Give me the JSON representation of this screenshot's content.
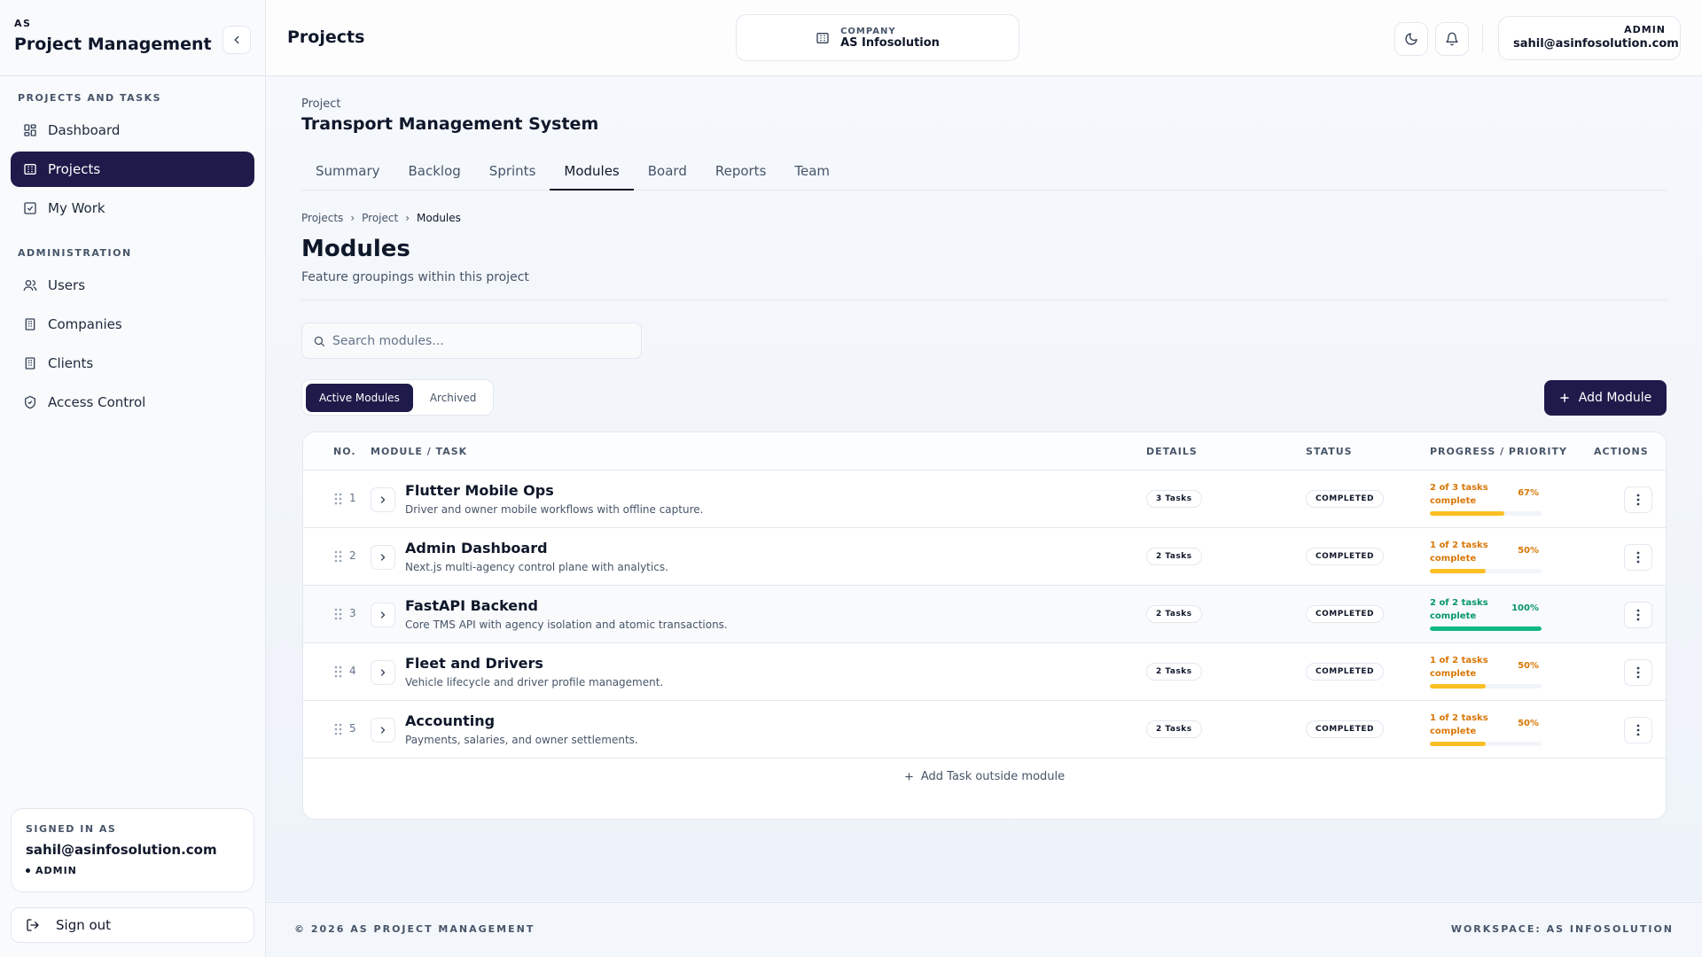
{
  "sidebar": {
    "brand_small": "AS",
    "brand_title": "Project Management",
    "sections": [
      {
        "label": "PROJECTS AND TASKS",
        "items": [
          {
            "label": "Dashboard",
            "icon": "dashboard-icon"
          },
          {
            "label": "Projects",
            "icon": "building-icon",
            "active": true
          },
          {
            "label": "My Work",
            "icon": "checkbox-icon"
          }
        ]
      },
      {
        "label": "ADMINISTRATION",
        "items": [
          {
            "label": "Users",
            "icon": "users-icon"
          },
          {
            "label": "Companies",
            "icon": "building-icon"
          },
          {
            "label": "Clients",
            "icon": "building-icon"
          },
          {
            "label": "Access Control",
            "icon": "shield-icon"
          }
        ]
      }
    ],
    "signed_in": {
      "label": "SIGNED IN AS",
      "email": "sahil@asinfosolution.com",
      "role": "ADMIN"
    },
    "sign_out": "Sign out"
  },
  "topbar": {
    "title": "Projects",
    "company_label": "COMPANY",
    "company_name": "AS Infosolution",
    "user_role": "ADMIN",
    "user_email": "sahil@asinfosolution.com"
  },
  "project": {
    "label": "Project",
    "name": "Transport Management System"
  },
  "tabs": [
    {
      "label": "Summary"
    },
    {
      "label": "Backlog"
    },
    {
      "label": "Sprints"
    },
    {
      "label": "Modules",
      "active": true
    },
    {
      "label": "Board"
    },
    {
      "label": "Reports"
    },
    {
      "label": "Team"
    }
  ],
  "breadcrumb": [
    "Projects",
    "Project",
    "Modules"
  ],
  "page": {
    "title": "Modules",
    "subtitle": "Feature groupings within this project"
  },
  "search": {
    "placeholder": "Search modules...",
    "value": ""
  },
  "filters": {
    "active": "Active Modules",
    "archived": "Archived"
  },
  "add_module": "Add Module",
  "table": {
    "headers": {
      "no": "NO.",
      "module": "MODULE / TASK",
      "details": "DETAILS",
      "status": "STATUS",
      "progress": "PROGRESS / PRIORITY",
      "actions": "ACTIONS"
    },
    "rows": [
      {
        "no": "1",
        "name": "Flutter Mobile Ops",
        "desc": "Driver and owner mobile workflows with offline capture.",
        "details": "3 Tasks",
        "status": "COMPLETED",
        "progress_text": "2 of 3 tasks complete",
        "pct_label": "67%",
        "pct": 67,
        "color": "#d97706",
        "bar": "#fbbf24"
      },
      {
        "no": "2",
        "name": "Admin Dashboard",
        "desc": "Next.js multi-agency control plane with analytics.",
        "details": "2 Tasks",
        "status": "COMPLETED",
        "progress_text": "1 of 2 tasks complete",
        "pct_label": "50%",
        "pct": 50,
        "color": "#d97706",
        "bar": "#fbbf24"
      },
      {
        "no": "3",
        "name": "FastAPI Backend",
        "desc": "Core TMS API with agency isolation and atomic transactions.",
        "details": "2 Tasks",
        "status": "COMPLETED",
        "progress_text": "2 of 2 tasks complete",
        "pct_label": "100%",
        "pct": 100,
        "color": "#059669",
        "bar": "#10b981"
      },
      {
        "no": "4",
        "name": "Fleet and Drivers",
        "desc": "Vehicle lifecycle and driver profile management.",
        "details": "2 Tasks",
        "status": "COMPLETED",
        "progress_text": "1 of 2 tasks complete",
        "pct_label": "50%",
        "pct": 50,
        "color": "#d97706",
        "bar": "#fbbf24"
      },
      {
        "no": "5",
        "name": "Accounting",
        "desc": "Payments, salaries, and owner settlements.",
        "details": "2 Tasks",
        "status": "COMPLETED",
        "progress_text": "1 of 2 tasks complete",
        "pct_label": "50%",
        "pct": 50,
        "color": "#d97706",
        "bar": "#fbbf24"
      }
    ],
    "add_task": "Add Task outside module"
  },
  "footer": {
    "left": "© 2026 AS PROJECT MANAGEMENT",
    "right": "WORKSPACE: AS INFOSOLUTION"
  }
}
